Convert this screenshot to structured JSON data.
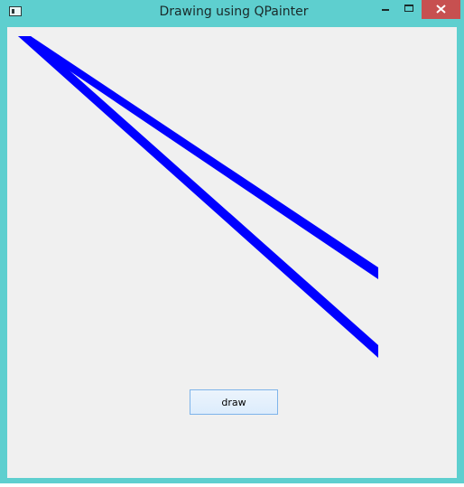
{
  "window": {
    "title": "Drawing using QPainter"
  },
  "titlebar": {
    "icon": "app-window-icon",
    "controls": [
      "minimize-icon",
      "maximize-icon",
      "close-icon"
    ],
    "close_color": "#c75050",
    "frame_color": "#5ecfcf"
  },
  "canvas": {
    "background": "#f0f0f0",
    "pen_color": "#0000ff",
    "line_count": 2
  },
  "actions": {
    "draw_label": "draw"
  }
}
